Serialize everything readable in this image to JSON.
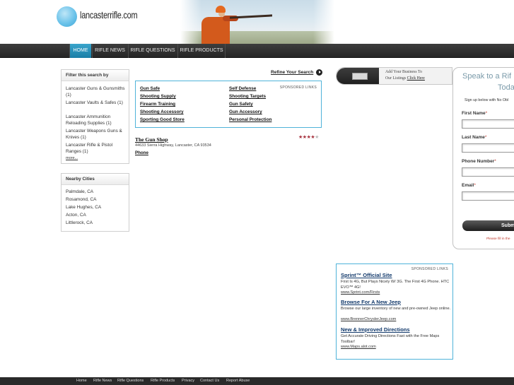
{
  "site": {
    "logo_text": "lancasterrifle.com"
  },
  "nav": [
    {
      "label": "HOME"
    },
    {
      "label": "RIFLE NEWS"
    },
    {
      "label": "RIFLE QUESTIONS"
    },
    {
      "label": "RIFLE PRODUCTS"
    }
  ],
  "filter": {
    "heading": "Filter this search by",
    "items": [
      {
        "label": "Lancaster Guns & Gunsmiths (1)"
      },
      {
        "label": "Lancaster Vaults & Safes (1)"
      },
      {
        "label": "Lancaster Ammunition Reloading Supplies (1)"
      },
      {
        "label": "Lancaster Weapons Guns & Knives (1)"
      },
      {
        "label": "Lancaster Rifle & Pistol Ranges (1)"
      }
    ],
    "more": "more..."
  },
  "nearby": {
    "heading": "Nearby Cities",
    "cities": [
      "Palmdale, CA",
      "Rosamond, CA",
      "Lake Hughes, CA",
      "Acton, CA",
      "Littlerock, CA"
    ]
  },
  "refine": {
    "label": "Refine Your Search"
  },
  "sponsored_top": {
    "label": "SPONSORED LINKS",
    "links": [
      "Gun Safe",
      "Self Defense",
      "Shooting Supply",
      "Shooting Targets",
      "Firearm Training",
      "Gun Safety",
      "Shooting Accessory",
      "Gun Accessory",
      "Sporting Good Store",
      "Personal Protection"
    ]
  },
  "listing": {
    "title": "The Gun Shop",
    "address": "44633 Sierra Highway, Lancaster, CA 93534",
    "phone_label": "Phone",
    "rating": 4,
    "rating_max": 5
  },
  "add_banner": {
    "line1": "Add Your Business To",
    "line2_prefix": "Our Listings",
    "line2_link": "Click Here"
  },
  "speak_panel": {
    "title_line1": "Speak to a Rif",
    "title_line2": "Toda",
    "subtitle": "Sign up below with No Obl",
    "fields": [
      {
        "label": "First Name",
        "required": "*"
      },
      {
        "label": "Last Name",
        "required": "*"
      },
      {
        "label": "Phone Number",
        "required": "*"
      },
      {
        "label": "Email",
        "required": "*"
      }
    ],
    "submit": "Subm",
    "note": "Please fill in the"
  },
  "sponsored_bottom": {
    "label": "SPONSORED LINKS",
    "ads": [
      {
        "title": "Sprint™ Official Site",
        "desc": "First Is 4G, But Plays Nicely W/ 3G. The First 4G Phone. HTC EVO™ 4G!",
        "url": "www.Sprint.com/Firsts"
      },
      {
        "title": "Browse For A New Jeep",
        "desc": "Browse our large inventory of new and pre-owned Jeep online.",
        "url": "www.BrennerChryslerJeep.com"
      },
      {
        "title": "New & Improved Directions",
        "desc": "Get Accurate Driving Directions Fast with the Free Maps Toolbar!",
        "url": "www.Maps.alot.com"
      }
    ]
  },
  "footer": {
    "links": [
      "Home",
      "Rifle News",
      "Rifle Questions",
      "Rifle Products",
      "Privacy",
      "Contact Us",
      "Report Abuse"
    ]
  },
  "colors": {
    "nav_active": "#1a7ea6",
    "sponsor_border": "#4fb3d9",
    "rating_star": "#a7333f",
    "ad_title": "#12396b"
  }
}
